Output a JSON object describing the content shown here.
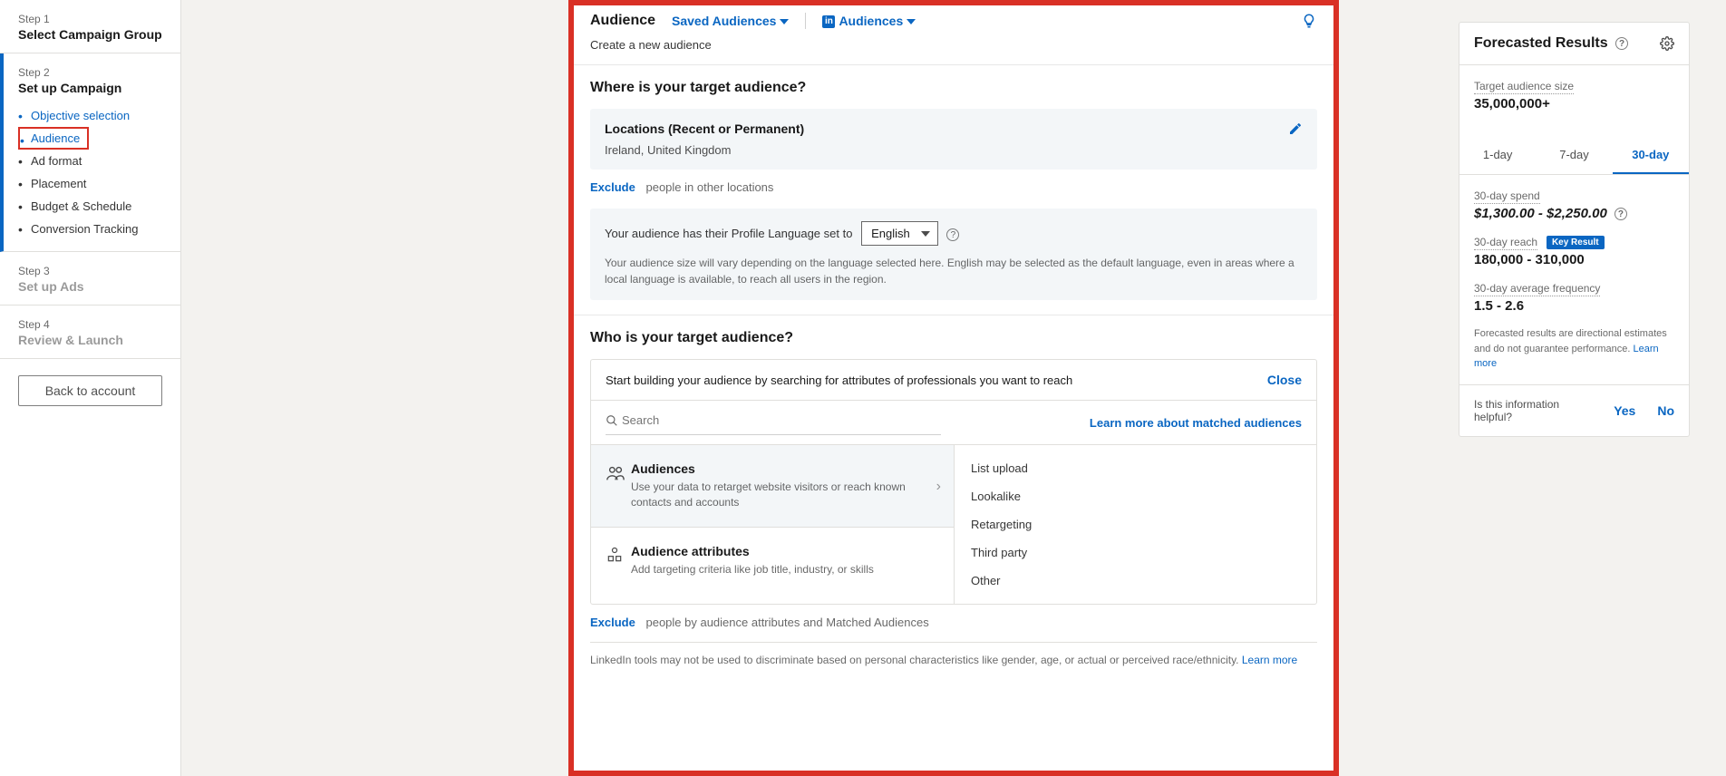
{
  "sidebar": {
    "step1": {
      "label": "Step 1",
      "title": "Select Campaign Group"
    },
    "step2": {
      "label": "Step 2",
      "title": "Set up Campaign",
      "items": [
        "Objective selection",
        "Audience",
        "Ad format",
        "Placement",
        "Budget & Schedule",
        "Conversion Tracking"
      ]
    },
    "step3": {
      "label": "Step 3",
      "title": "Set up Ads"
    },
    "step4": {
      "label": "Step 4",
      "title": "Review & Launch"
    },
    "back_button": "Back to account"
  },
  "audience_panel": {
    "title": "Audience",
    "saved_link": "Saved Audiences",
    "ln_link": "Audiences",
    "subtitle": "Create a new audience",
    "where_heading": "Where is your target audience?",
    "locations_title": "Locations (Recent or Permanent)",
    "locations_value": "Ireland, United Kingdom",
    "exclude_label": "Exclude",
    "exclude_text": "people in other locations",
    "lang_prefix": "Your audience has their Profile Language set to",
    "lang_value": "English",
    "lang_note": "Your audience size will vary depending on the language selected here. English may be selected as the default language, even in areas where a local language is available, to reach all users in the region.",
    "who_heading": "Who is your target audience?",
    "builder_prompt": "Start building your audience by searching for attributes of professionals you want to reach",
    "close_label": "Close",
    "search_placeholder": "Search",
    "matched_link": "Learn more about matched audiences",
    "cat_audiences_title": "Audiences",
    "cat_audiences_desc": "Use your data to retarget website visitors or reach known contacts and accounts",
    "cat_attrs_title": "Audience attributes",
    "cat_attrs_desc": "Add targeting criteria like job title, industry, or skills",
    "options": [
      "List upload",
      "Lookalike",
      "Retargeting",
      "Third party",
      "Other"
    ],
    "exclude2_label": "Exclude",
    "exclude2_text": "people by audience attributes and Matched Audiences",
    "disclaimer": "LinkedIn tools may not be used to discriminate based on personal characteristics like gender, age, or actual or perceived race/ethnicity.",
    "learn_more": "Learn more"
  },
  "forecast": {
    "title": "Forecasted Results",
    "audience_size_label": "Target audience size",
    "audience_size_value": "35,000,000+",
    "tabs": [
      "1-day",
      "7-day",
      "30-day"
    ],
    "spend_label": "30-day spend",
    "spend_value": "$1,300.00 - $2,250.00",
    "reach_label": "30-day reach",
    "reach_value": "180,000 - 310,000",
    "key_result": "Key Result",
    "freq_label": "30-day average frequency",
    "freq_value": "1.5 - 2.6",
    "disclaimer": "Forecasted results are directional estimates and do not guarantee performance.",
    "learn_more": "Learn more",
    "feedback_question": "Is this information helpful?",
    "yes": "Yes",
    "no": "No"
  }
}
